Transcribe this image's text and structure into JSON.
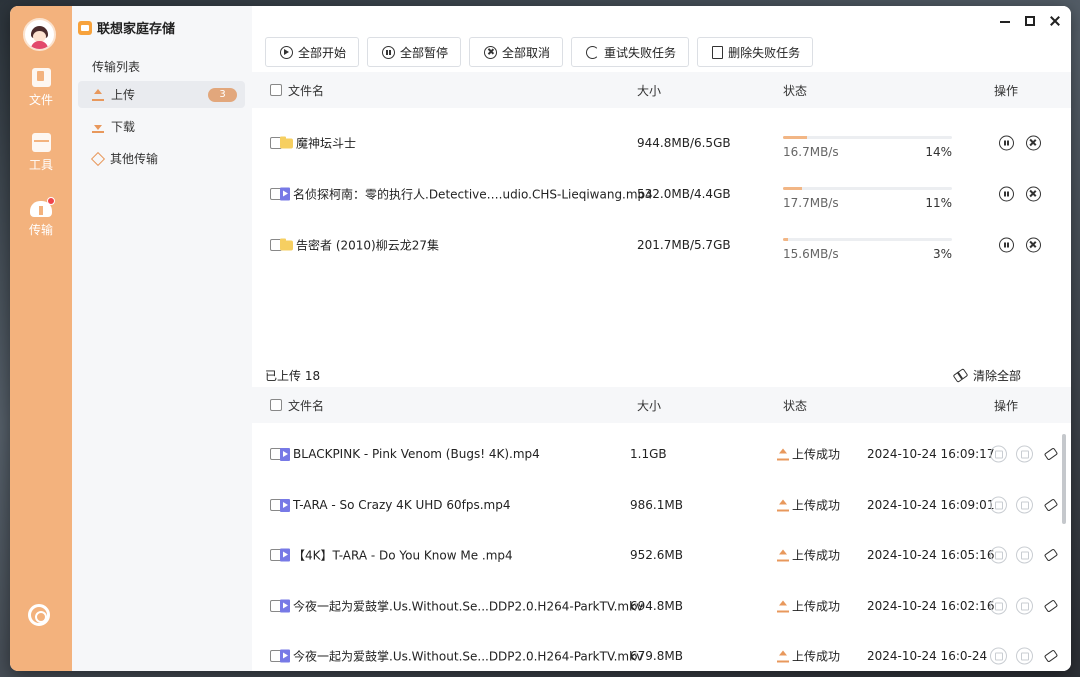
{
  "app": {
    "title": "联想家庭存储"
  },
  "rail": {
    "items": [
      {
        "label": "文件",
        "icon": "file-icon"
      },
      {
        "label": "工具",
        "icon": "toolbox-icon"
      },
      {
        "label": "传输",
        "icon": "cloud-transfer-icon"
      }
    ],
    "settings_icon": "gear-icon"
  },
  "sidebar": {
    "section_title": "传输列表",
    "items": [
      {
        "label": "上传",
        "badge": "3",
        "icon": "upload-icon"
      },
      {
        "label": "下载",
        "icon": "download-icon"
      },
      {
        "label": "其他传输",
        "icon": "other-transfer-icon"
      }
    ]
  },
  "toolbar": {
    "start_all": "全部开始",
    "pause_all": "全部暂停",
    "cancel_all": "全部取消",
    "retry_failed": "重试失败任务",
    "delete_failed": "删除失败任务"
  },
  "columns": {
    "name": "文件名",
    "size": "大小",
    "status": "状态",
    "actions": "操作"
  },
  "uploading": [
    {
      "name": "魔神坛斗士",
      "type": "folder",
      "size": "944.8MB/6.5GB",
      "speed": "16.7MB/s",
      "percent": "14%",
      "progress": 0.14
    },
    {
      "name": "名侦探柯南：零的执行人.Detective….udio.CHS-Lieqiwang.mp4",
      "type": "video",
      "size": "532.0MB/4.4GB",
      "speed": "17.7MB/s",
      "percent": "11%",
      "progress": 0.11
    },
    {
      "name": "告密者 (2010)柳云龙27集",
      "type": "folder",
      "size": "201.7MB/5.7GB",
      "speed": "15.6MB/s",
      "percent": "3%",
      "progress": 0.03
    }
  ],
  "completed": {
    "count_label": "已上传 18",
    "clear_all": "清除全部",
    "items": [
      {
        "name": "BLACKPINK - Pink Venom (Bugs! 4K).mp4",
        "size": "1.1GB",
        "status": "上传成功",
        "time": "2024-10-24 16:09:17"
      },
      {
        "name": "T-ARA - So Crazy 4K UHD 60fps.mp4",
        "size": "986.1MB",
        "status": "上传成功",
        "time": "2024-10-24 16:09:01"
      },
      {
        "name": "【4K】T-ARA - Do You Know Me .mp4",
        "size": "952.6MB",
        "status": "上传成功",
        "time": "2024-10-24 16:05:16"
      },
      {
        "name": "今夜一起为爱鼓掌.Us.Without.Se...DDP2.0.H264-ParkTV.mkv",
        "size": "694.8MB",
        "status": "上传成功",
        "time": "2024-10-24 16:02:16"
      },
      {
        "name": "今夜一起为爱鼓掌.Us.Without.Se...DDP2.0.H264-ParkTV.mkv",
        "size": "679.8MB",
        "status": "上传成功",
        "time": "2024-10-24 16:0-24"
      }
    ]
  },
  "colors": {
    "rail": "#f3b27d",
    "accent": "#e8985c",
    "video": "#7779e6",
    "folder": "#f6cf61"
  }
}
